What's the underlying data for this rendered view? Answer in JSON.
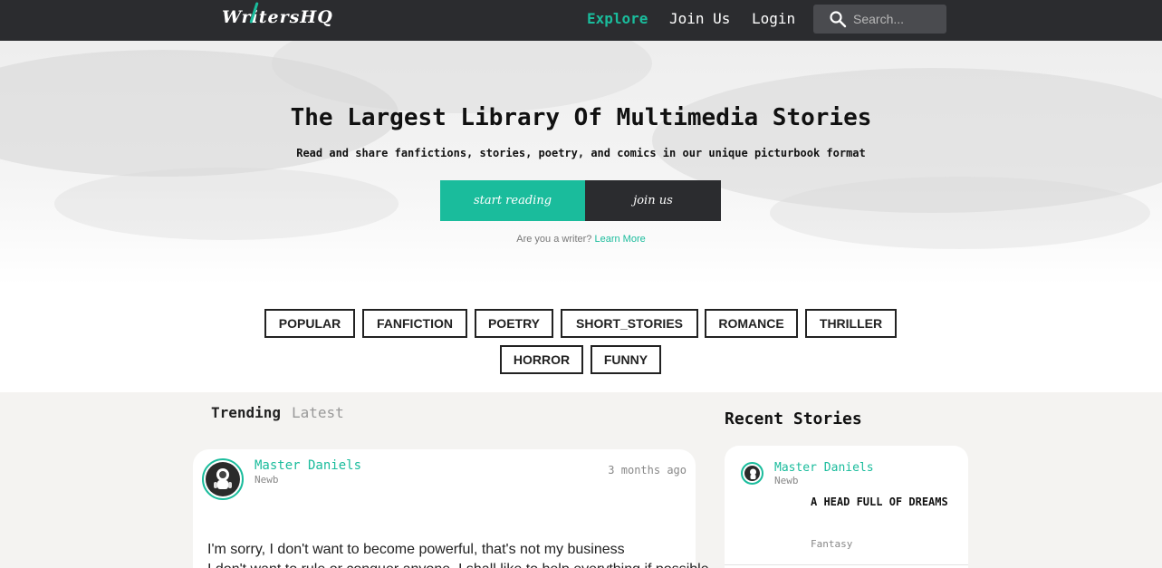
{
  "nav": {
    "logo": "WritersHQ",
    "links": [
      "Explore",
      "Join Us",
      "Login"
    ],
    "search_placeholder": "Search..."
  },
  "hero": {
    "title": "The Largest Library Of Multimedia Stories",
    "subtitle": "Read and share fanfictions, stories, poetry, and comics in our unique picturbook format",
    "start_button": "start reading",
    "join_button": "join us",
    "writer_prompt": "Are you a writer?",
    "learn_more": "Learn More"
  },
  "categories": [
    "POPULAR",
    "FANFICTION",
    "POETRY",
    "SHORT_STORIES",
    "ROMANCE",
    "THRILLER",
    "HORROR",
    "FUNNY"
  ],
  "feed": {
    "tabs": [
      "Trending",
      "Latest"
    ],
    "post": {
      "author": "Master Daniels",
      "rank": "Newb",
      "time": "3 months ago",
      "text_line1": "I'm sorry, I don't want to become powerful, that's not my business",
      "text_line2": "I don't want to rule or conquer anyone. I shall like to help everything if possible"
    }
  },
  "recent": {
    "heading": "Recent Stories",
    "story": {
      "author": "Master Daniels",
      "rank": "Newb",
      "title": "A HEAD FULL OF DREAMS",
      "genre": "Fantasy"
    }
  },
  "colors": {
    "accent": "#1abc9c",
    "nav_bg": "#2b2c2f"
  }
}
